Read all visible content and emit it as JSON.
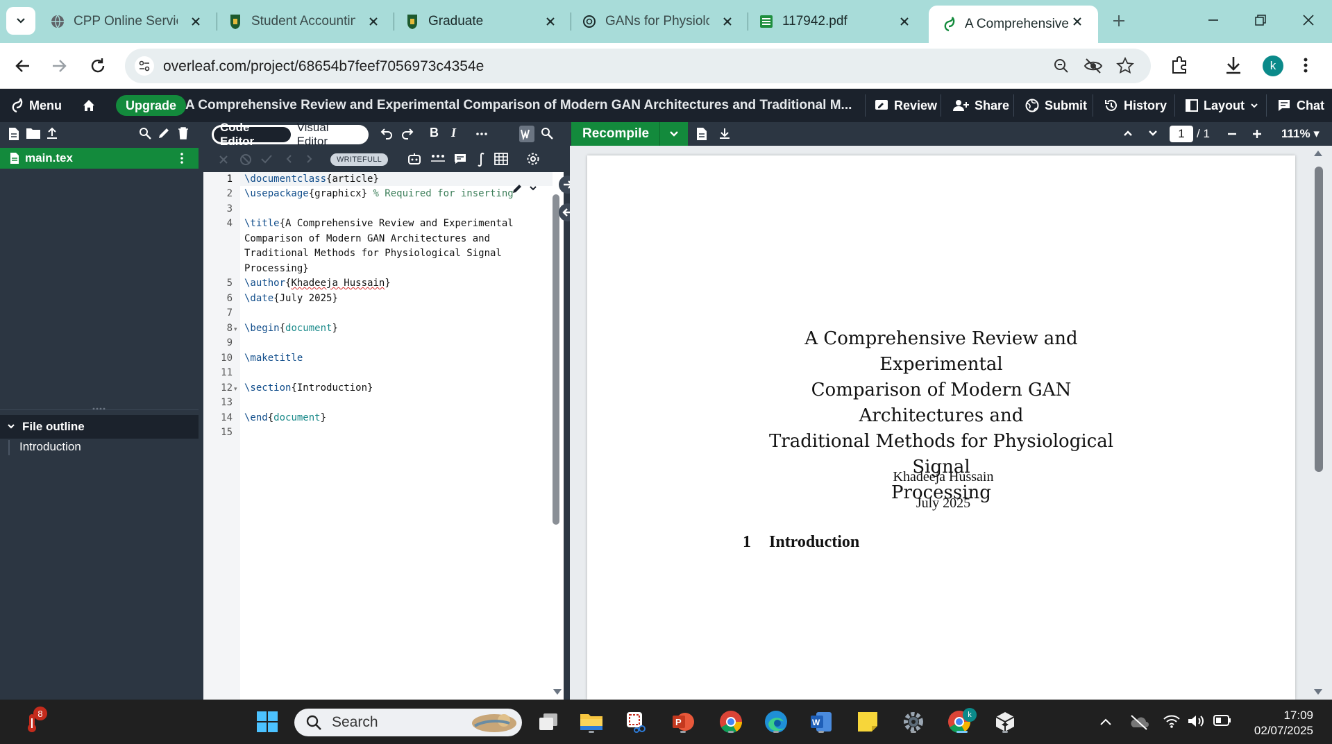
{
  "browser": {
    "tabs": [
      {
        "title": "CPP Online Service",
        "icon": "globe-icon"
      },
      {
        "title": "Student Accounting",
        "icon": "cpp-logo-icon"
      },
      {
        "title": "Graduate",
        "icon": "cpp-logo-icon"
      },
      {
        "title": "GANs for Physiolog",
        "icon": "chatgpt-icon"
      },
      {
        "title": "117942.pdf",
        "icon": "sheets-icon"
      },
      {
        "title": "A Comprehensive",
        "icon": "overleaf-icon",
        "active": true
      }
    ],
    "url": "overleaf.com/project/68654b7feef7056973c4354e",
    "avatar_letter": "k"
  },
  "overleaf": {
    "menu_label": "Menu",
    "upgrade_label": "Upgrade",
    "project_title": "A Comprehensive Review and Experimental Comparison of Modern GAN Architectures and Traditional M...",
    "header_actions": {
      "review": "Review",
      "share": "Share",
      "submit": "Submit",
      "history": "History",
      "layout": "Layout",
      "chat": "Chat"
    },
    "editor_modes": {
      "code": "Code Editor",
      "visual": "Visual Editor"
    },
    "writefull_label": "WRITEFULL",
    "recompile_label": "Recompile",
    "pdf_page_current": "1",
    "pdf_page_total": "/ 1",
    "pdf_zoom": "111%",
    "accent_color": "#138a3c"
  },
  "sidebar": {
    "active_file": "main.tex",
    "outline_title": "File outline",
    "outline_items": [
      "Introduction"
    ]
  },
  "editor": {
    "lines": [
      {
        "n": "1"
      },
      {
        "n": "2"
      },
      {
        "n": "3"
      },
      {
        "n": "4"
      },
      {
        "n": "5"
      },
      {
        "n": "6"
      },
      {
        "n": "7"
      },
      {
        "n": "8"
      },
      {
        "n": "9"
      },
      {
        "n": "10"
      },
      {
        "n": "11"
      },
      {
        "n": "12"
      },
      {
        "n": "13"
      },
      {
        "n": "14"
      },
      {
        "n": "15"
      }
    ],
    "code": {
      "l1_cmd": "\\documentclass",
      "l1_arg": "{article}",
      "l2_cmd": "\\usepackage",
      "l2_arg": "{graphicx}",
      "l2_comment": " % Required for inserting",
      "l4_cmd": "\\title",
      "l4_a": "{A Comprehensive Review and Experimental",
      "l4_b": "Comparison of Modern GAN Architectures and",
      "l4_c": "Traditional Methods for Physiological Signal",
      "l4_d": "Processing}",
      "l5_cmd": "\\author",
      "l5_open": "{",
      "l5_name": "Khadeeja Hussain",
      "l5_close": "}",
      "l6_cmd": "\\date",
      "l6_arg": "{July 2025}",
      "l8_cmd": "\\begin",
      "l8_open": "{",
      "l8_env": "document",
      "l8_close": "}",
      "l10_cmd": "\\maketitle",
      "l12_cmd": "\\section",
      "l12_arg": "{Introduction}",
      "l14_cmd": "\\end",
      "l14_open": "{",
      "l14_env": "document",
      "l14_close": "}"
    }
  },
  "pdf": {
    "title_lines": [
      "A Comprehensive Review and Experimental",
      "Comparison of Modern GAN Architectures and",
      "Traditional Methods for Physiological Signal",
      "Processing"
    ],
    "author": "Khadeeja Hussain",
    "date": "July 2025",
    "section_number": "1",
    "section_title": "Introduction"
  },
  "taskbar": {
    "search_placeholder": "Search",
    "weather_badge": "8",
    "time": "17:09",
    "date": "02/07/2025",
    "apps": [
      "start-icon",
      "search-icon",
      "task-view-icon",
      "file-explorer-icon",
      "snipping-tool-icon",
      "powerpoint-icon",
      "chrome-icon",
      "edge-icon",
      "word-icon",
      "sticky-notes-icon",
      "settings-icon",
      "chrome-profile-icon",
      "virtualbox-icon"
    ]
  }
}
